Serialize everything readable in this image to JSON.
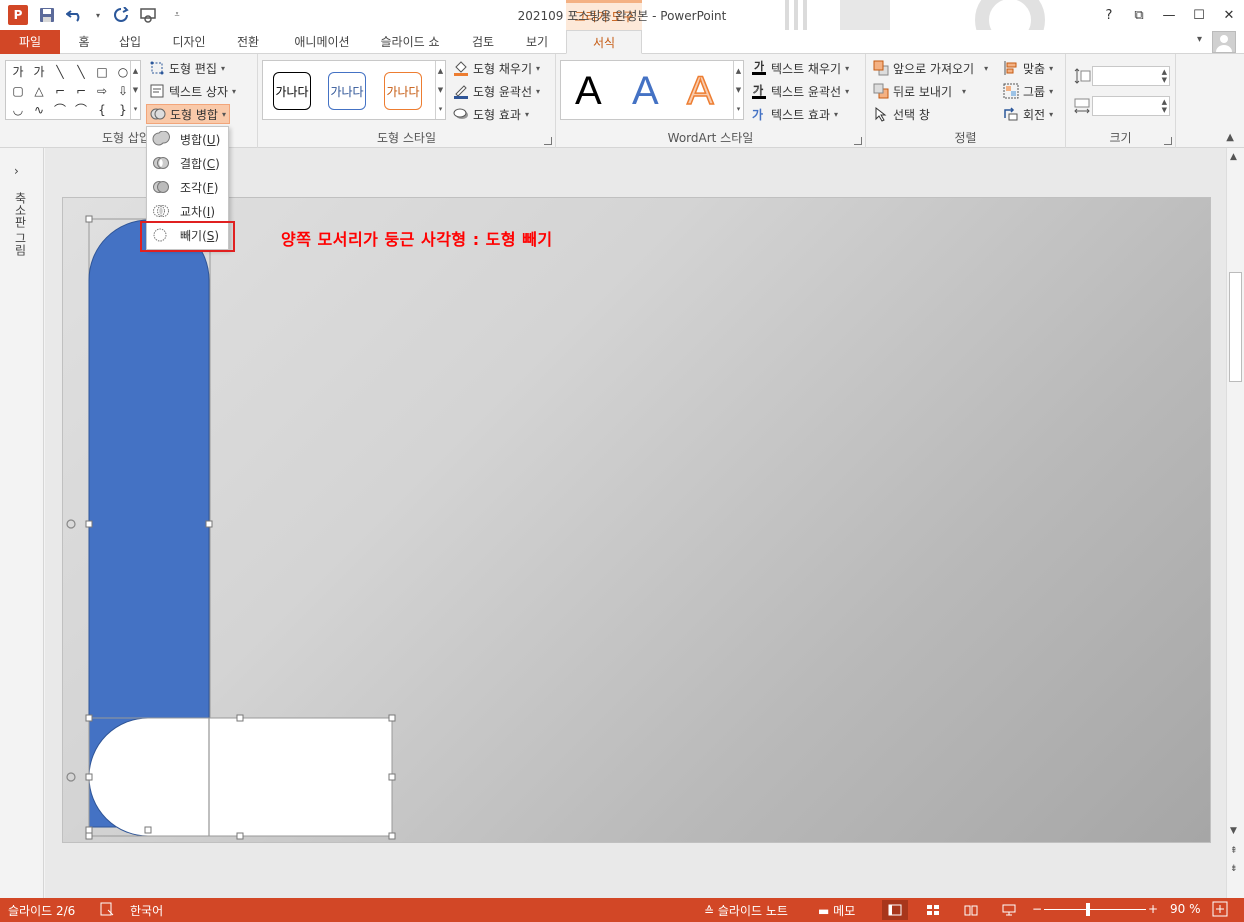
{
  "window": {
    "title": "202109 포스팅용 완성본 - PowerPoint",
    "context_tab_title": "그리기 도구",
    "app_logo": "P",
    "help": "?",
    "restore_ribbon": "⧉",
    "minimize": "—",
    "maximize": "☐",
    "close": "✕"
  },
  "qat": {
    "save_icon": "save-icon",
    "undo_icon": "undo-icon",
    "redo_icon": "redo-icon",
    "presenter_icon": "start-from-beginning-icon",
    "customize_icon": "customize-qat-icon"
  },
  "tabs": {
    "file": "파일",
    "home": "홈",
    "insert": "삽입",
    "design": "디자인",
    "transitions": "전환",
    "animations": "애니메이션",
    "slideshow": "슬라이드 쇼",
    "review": "검토",
    "view": "보기",
    "format": "서식"
  },
  "ribbon": {
    "insert_shapes": {
      "label": "도형 삽입",
      "edit_shape": "도형 편집",
      "text_box": "텍스트 상자",
      "merge_shapes": "도형 병합",
      "gallery_row1": [
        "가",
        "가",
        "╲",
        "╲",
        "□",
        "○"
      ],
      "gallery_row2": [
        "▢",
        "△",
        "⌐",
        "⌐",
        "⇨",
        "⇩"
      ],
      "gallery_row3": [
        "◡",
        "∿",
        "⌒",
        "⌒",
        "{",
        "}"
      ]
    },
    "shape_styles": {
      "label": "도형 스타일",
      "sample_text": "가나다",
      "fill": "도형 채우기",
      "outline": "도형 윤곽선",
      "effects": "도형 효과",
      "colors": [
        "#000000",
        "#4472c4",
        "#ed7d31"
      ]
    },
    "wordart": {
      "label": "WordArt 스타일",
      "letter": "A",
      "text_fill": "텍스트 채우기",
      "text_outline": "텍스트 윤곽선",
      "text_effects": "텍스트 효과",
      "fill_glyph": "가"
    },
    "arrange": {
      "label": "정렬",
      "bring_forward": "앞으로 가져오기",
      "send_backward": "뒤로 보내기",
      "selection_pane": "선택 창",
      "align": "맞춤",
      "group": "그룹",
      "rotate": "회전"
    },
    "size": {
      "label": "크기",
      "height_value": "",
      "width_value": ""
    }
  },
  "merge_menu": {
    "items": [
      {
        "label": "병합",
        "key": "U"
      },
      {
        "label": "결합",
        "key": "C"
      },
      {
        "label": "조각",
        "key": "F"
      },
      {
        "label": "교차",
        "key": "I"
      },
      {
        "label": "빼기",
        "key": "S"
      }
    ]
  },
  "left_pane": {
    "expand": "›",
    "label": "축소판 그림"
  },
  "slide": {
    "caption": "양쪽 모서리가 둥근 사각형 : 도형 빼기",
    "colors": {
      "blue_shape": "#4472c4",
      "white_shape": "#ffffff",
      "outline": "#2f5597"
    }
  },
  "status": {
    "slide_info": "슬라이드 2/6",
    "language": "한국어",
    "notes": "슬라이드 노트",
    "comments": "메모",
    "zoom": "90 %",
    "zoom_minus": "−",
    "zoom_plus": "+"
  },
  "colors": {
    "accent": "#d24726",
    "context_tab": "#c55a11",
    "highlight": "#e02020"
  }
}
